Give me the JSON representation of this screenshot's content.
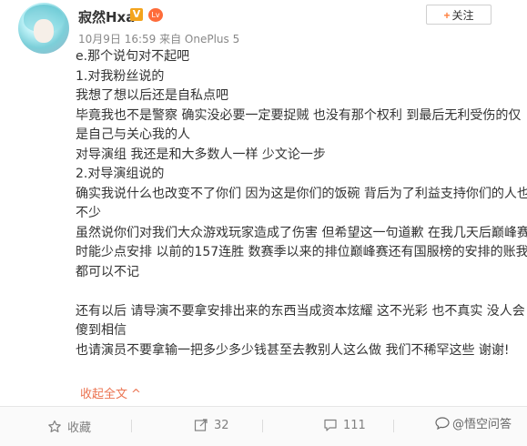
{
  "author": {
    "name": "寂然Hxa",
    "verified_badge": "V",
    "level_badge": "Lv",
    "meta": "10月9日 16:59 来自 OnePlus 5"
  },
  "follow_button": {
    "label": "关注",
    "plus": "+"
  },
  "post": {
    "lines": [
      "e.那个说句对不起吧",
      "1.对我粉丝说的",
      "我想了想以后还是自私点吧",
      "毕竟我也不是警察 确实没必要一定要捉贼 也没有那个权利 到最后无利受伤的仅",
      "是自己与关心我的人",
      "对导演组 我还是和大多数人一样 少文论一步",
      "2.对导演组说的",
      "确实我说什么也改变不了你们 因为这是你们的饭碗 背后为了利益支持你们的人也",
      "不少",
      "虽然说你们对我们大众游戏玩家造成了伤害 但希望这一句道歉 在我几天后巅峰赛",
      "时能少点安排 以前的157连胜 数赛季以来的排位巅峰赛还有国服榜的安排的账我",
      "都可以不记",
      "",
      "还有以后 请导演不要拿安排出来的东西当成资本炫耀 这不光彩 也不真实 没人会",
      "傻到相信",
      "也请演员不要拿输一把多少多少钱甚至去教别人这么做 我们不稀罕这些 谢谢!"
    ],
    "collapse_label": "收起全文",
    "collapse_arrow": "^"
  },
  "actions": {
    "favorite_label": "收藏",
    "repost_count": "32",
    "comment_count": "111"
  },
  "watermark": {
    "text": "@悟空问答"
  },
  "colors": {
    "accent": "#eb7350",
    "verified": "#f3a41d",
    "text": "#333333",
    "meta": "#888888"
  }
}
